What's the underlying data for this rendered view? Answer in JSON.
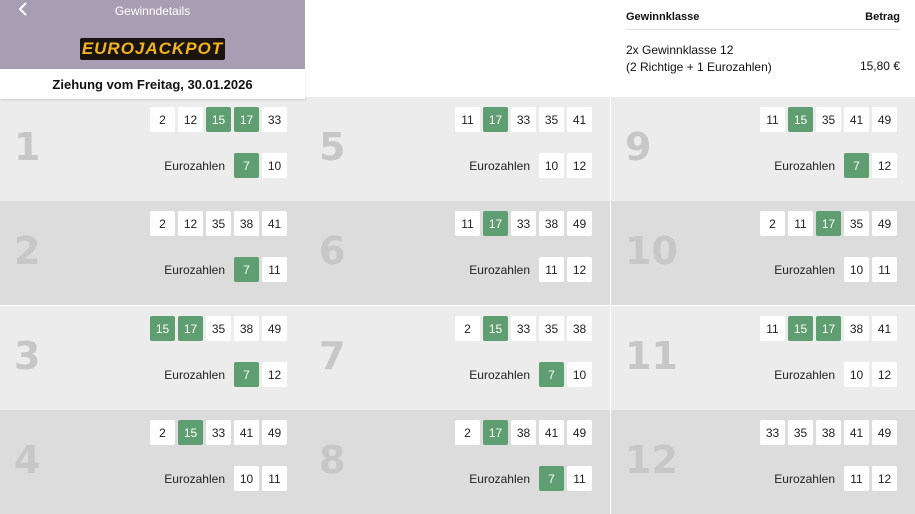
{
  "header": {
    "title": "Gewinndetails",
    "logo_text": "EUROJACKPOT"
  },
  "draw_date": "Ziehung vom Freitag, 30.01.2026",
  "euro_label": "Eurozahlen",
  "prize": {
    "col_class": "Gewinnklasse",
    "col_amount": "Betrag",
    "class_line1": "2x Gewinnklasse 12",
    "class_line2": "(2 Richtige + 1 Eurozahlen)",
    "amount": "15,80 €"
  },
  "colors": {
    "hit": "#5e9e70",
    "header_bg": "#a89eb3",
    "logo": "#f2b41e"
  },
  "tickets": [
    {
      "num": "1",
      "main": [
        {
          "v": "2",
          "hit": false
        },
        {
          "v": "12",
          "hit": false
        },
        {
          "v": "15",
          "hit": true
        },
        {
          "v": "17",
          "hit": true
        },
        {
          "v": "33",
          "hit": false
        }
      ],
      "euro": [
        {
          "v": "7",
          "hit": true
        },
        {
          "v": "10",
          "hit": false
        }
      ]
    },
    {
      "num": "2",
      "main": [
        {
          "v": "2",
          "hit": false
        },
        {
          "v": "12",
          "hit": false
        },
        {
          "v": "35",
          "hit": false
        },
        {
          "v": "38",
          "hit": false
        },
        {
          "v": "41",
          "hit": false
        }
      ],
      "euro": [
        {
          "v": "7",
          "hit": true
        },
        {
          "v": "11",
          "hit": false
        }
      ]
    },
    {
      "num": "3",
      "main": [
        {
          "v": "15",
          "hit": true
        },
        {
          "v": "17",
          "hit": true
        },
        {
          "v": "35",
          "hit": false
        },
        {
          "v": "38",
          "hit": false
        },
        {
          "v": "49",
          "hit": false
        }
      ],
      "euro": [
        {
          "v": "7",
          "hit": true
        },
        {
          "v": "12",
          "hit": false
        }
      ]
    },
    {
      "num": "4",
      "main": [
        {
          "v": "2",
          "hit": false
        },
        {
          "v": "15",
          "hit": true
        },
        {
          "v": "33",
          "hit": false
        },
        {
          "v": "41",
          "hit": false
        },
        {
          "v": "49",
          "hit": false
        }
      ],
      "euro": [
        {
          "v": "10",
          "hit": false
        },
        {
          "v": "11",
          "hit": false
        }
      ]
    },
    {
      "num": "5",
      "main": [
        {
          "v": "11",
          "hit": false
        },
        {
          "v": "17",
          "hit": true
        },
        {
          "v": "33",
          "hit": false
        },
        {
          "v": "35",
          "hit": false
        },
        {
          "v": "41",
          "hit": false
        }
      ],
      "euro": [
        {
          "v": "10",
          "hit": false
        },
        {
          "v": "12",
          "hit": false
        }
      ]
    },
    {
      "num": "6",
      "main": [
        {
          "v": "11",
          "hit": false
        },
        {
          "v": "17",
          "hit": true
        },
        {
          "v": "33",
          "hit": false
        },
        {
          "v": "38",
          "hit": false
        },
        {
          "v": "49",
          "hit": false
        }
      ],
      "euro": [
        {
          "v": "11",
          "hit": false
        },
        {
          "v": "12",
          "hit": false
        }
      ]
    },
    {
      "num": "7",
      "main": [
        {
          "v": "2",
          "hit": false
        },
        {
          "v": "15",
          "hit": true
        },
        {
          "v": "33",
          "hit": false
        },
        {
          "v": "35",
          "hit": false
        },
        {
          "v": "38",
          "hit": false
        }
      ],
      "euro": [
        {
          "v": "7",
          "hit": true
        },
        {
          "v": "10",
          "hit": false
        }
      ]
    },
    {
      "num": "8",
      "main": [
        {
          "v": "2",
          "hit": false
        },
        {
          "v": "17",
          "hit": true
        },
        {
          "v": "38",
          "hit": false
        },
        {
          "v": "41",
          "hit": false
        },
        {
          "v": "49",
          "hit": false
        }
      ],
      "euro": [
        {
          "v": "7",
          "hit": true
        },
        {
          "v": "11",
          "hit": false
        }
      ]
    },
    {
      "num": "9",
      "main": [
        {
          "v": "11",
          "hit": false
        },
        {
          "v": "15",
          "hit": true
        },
        {
          "v": "35",
          "hit": false
        },
        {
          "v": "41",
          "hit": false
        },
        {
          "v": "49",
          "hit": false
        }
      ],
      "euro": [
        {
          "v": "7",
          "hit": true
        },
        {
          "v": "12",
          "hit": false
        }
      ]
    },
    {
      "num": "10",
      "main": [
        {
          "v": "2",
          "hit": false
        },
        {
          "v": "11",
          "hit": false
        },
        {
          "v": "17",
          "hit": true
        },
        {
          "v": "35",
          "hit": false
        },
        {
          "v": "49",
          "hit": false
        }
      ],
      "euro": [
        {
          "v": "10",
          "hit": false
        },
        {
          "v": "11",
          "hit": false
        }
      ]
    },
    {
      "num": "11",
      "main": [
        {
          "v": "11",
          "hit": false
        },
        {
          "v": "15",
          "hit": true
        },
        {
          "v": "17",
          "hit": true
        },
        {
          "v": "38",
          "hit": false
        },
        {
          "v": "41",
          "hit": false
        }
      ],
      "euro": [
        {
          "v": "10",
          "hit": false
        },
        {
          "v": "12",
          "hit": false
        }
      ]
    },
    {
      "num": "12",
      "main": [
        {
          "v": "33",
          "hit": false
        },
        {
          "v": "35",
          "hit": false
        },
        {
          "v": "38",
          "hit": false
        },
        {
          "v": "41",
          "hit": false
        },
        {
          "v": "49",
          "hit": false
        }
      ],
      "euro": [
        {
          "v": "11",
          "hit": false
        },
        {
          "v": "12",
          "hit": false
        }
      ]
    }
  ]
}
